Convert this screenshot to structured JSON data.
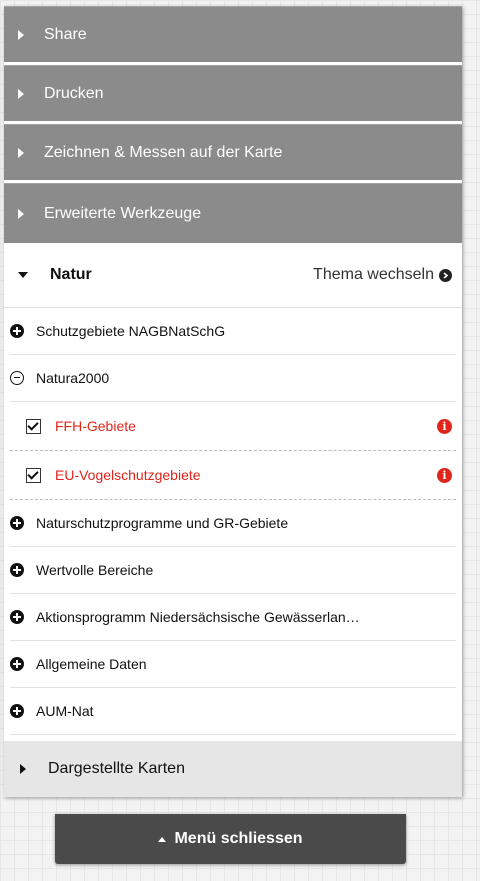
{
  "tools": [
    {
      "label": "Share"
    },
    {
      "label": "Drucken"
    },
    {
      "label": "Zeichnen & Messen auf der Karte"
    },
    {
      "label": "Erweiterte Werkzeuge"
    }
  ],
  "topic": {
    "title": "Natur",
    "switch_label": "Thema wechseln"
  },
  "layers": {
    "schutzgebiete": "Schutzgebiete NAGBNatSchG",
    "natura2000": "Natura2000",
    "natura_children": [
      {
        "label": "FFH-Gebiete",
        "checked": true
      },
      {
        "label": "EU-Vogelschutzgebiete",
        "checked": true
      }
    ],
    "rest": [
      {
        "label": "Naturschutzprogramme und GR-Gebiete"
      },
      {
        "label": "Wertvolle Bereiche"
      },
      {
        "label": "Aktionsprogramm Niedersächsische Gewässerlan…"
      },
      {
        "label": "Allgemeine Daten"
      },
      {
        "label": "AUM-Nat"
      }
    ]
  },
  "displayed_maps_label": "Dargestellte Karten",
  "menu_close_label": "Menü schliessen",
  "colors": {
    "tool_header_bg": "#8b8b8b",
    "layer_active": "#e1251b",
    "menu_close_bg": "#4a4a4a"
  },
  "icons": {
    "expand": "plus-circle-icon",
    "collapse": "minus-circle-icon",
    "info": "info-icon",
    "switch": "chevron-right-circle-icon"
  }
}
